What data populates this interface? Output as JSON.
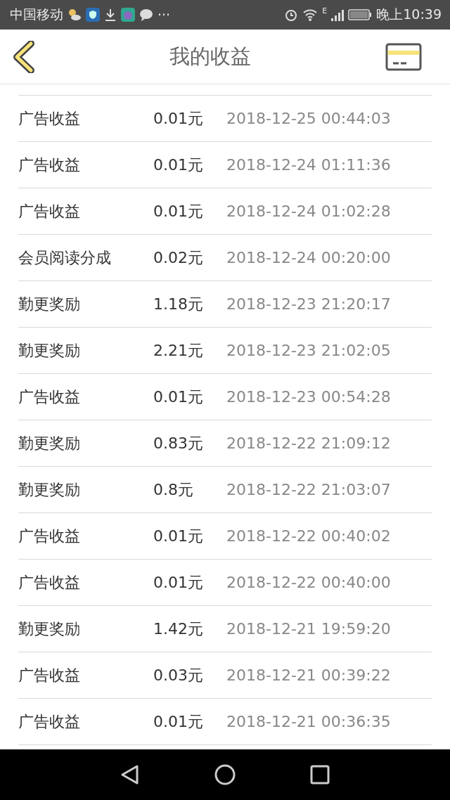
{
  "status_bar": {
    "carrier": "中国移动",
    "more": "···",
    "network": "E",
    "time": "晚上10:39"
  },
  "header": {
    "title": "我的收益"
  },
  "records": [
    {
      "type": "广告收益",
      "amount": "0.01元",
      "time": "2018-12-25 00:44:03"
    },
    {
      "type": "广告收益",
      "amount": "0.01元",
      "time": "2018-12-24 01:11:36"
    },
    {
      "type": "广告收益",
      "amount": "0.01元",
      "time": "2018-12-24 01:02:28"
    },
    {
      "type": "会员阅读分成",
      "amount": "0.02元",
      "time": "2018-12-24 00:20:00"
    },
    {
      "type": "勤更奖励",
      "amount": "1.18元",
      "time": "2018-12-23 21:20:17"
    },
    {
      "type": "勤更奖励",
      "amount": "2.21元",
      "time": "2018-12-23 21:02:05"
    },
    {
      "type": "广告收益",
      "amount": "0.01元",
      "time": "2018-12-23 00:54:28"
    },
    {
      "type": "勤更奖励",
      "amount": "0.83元",
      "time": "2018-12-22 21:09:12"
    },
    {
      "type": "勤更奖励",
      "amount": "0.8元",
      "time": "2018-12-22 21:03:07"
    },
    {
      "type": "广告收益",
      "amount": "0.01元",
      "time": "2018-12-22 00:40:02"
    },
    {
      "type": "广告收益",
      "amount": "0.01元",
      "time": "2018-12-22 00:40:00"
    },
    {
      "type": "勤更奖励",
      "amount": "1.42元",
      "time": "2018-12-21 19:59:20"
    },
    {
      "type": "广告收益",
      "amount": "0.03元",
      "time": "2018-12-21 00:39:22"
    },
    {
      "type": "广告收益",
      "amount": "0.01元",
      "time": "2018-12-21 00:36:35"
    }
  ]
}
